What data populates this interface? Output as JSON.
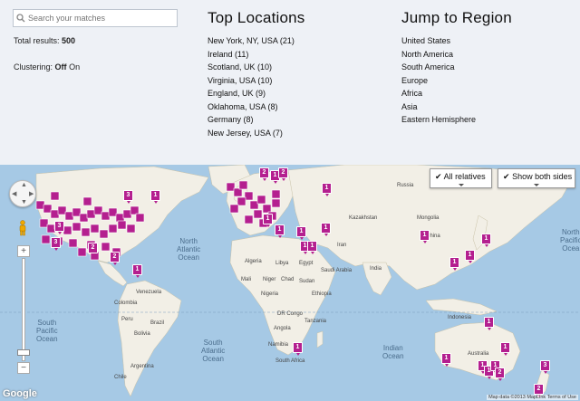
{
  "search": {
    "placeholder": "Search your matches"
  },
  "total": {
    "label": "Total results:",
    "value": "500"
  },
  "clustering": {
    "label": "Clustering:",
    "off": "Off",
    "on": "On"
  },
  "top_locations": {
    "title": "Top Locations",
    "items": [
      "New York, NY, USA (21)",
      "Ireland (11)",
      "Scotland, UK (10)",
      "Virginia, USA (10)",
      "England, UK (9)",
      "Oklahoma, USA (8)",
      "Germany (8)",
      "New Jersey, USA (7)"
    ]
  },
  "jump_to_region": {
    "title": "Jump to Region",
    "items": [
      "United States",
      "North America",
      "South America",
      "Europe",
      "Africa",
      "Asia",
      "Eastern Hemisphere"
    ]
  },
  "map": {
    "buttons": {
      "relatives": "All relatives",
      "sides": "Show both sides"
    },
    "zoom_in": "+",
    "zoom_out": "−",
    "oceans": {
      "north_pacific": "North\nPacific\nOcean",
      "north_atlantic": "North\nAtlantic\nOcean",
      "south_pacific": "South\nPacific\nOcean",
      "south_atlantic": "South\nAtlantic\nOcean",
      "indian": "Indian\nOcean",
      "north_pacific_east": "North\nPacific\nOcea"
    },
    "countries": {
      "russia": "Russia",
      "kazakhstan": "Kazakhstan",
      "mongolia": "Mongolia",
      "china": "China",
      "iran": "Iran",
      "algeria": "Algeria",
      "libya": "Libya",
      "egypt": "Egypt",
      "saudi": "Saudi Arabia",
      "india": "India",
      "mali": "Mali",
      "niger": "Niger",
      "chad": "Chad",
      "sudan": "Sudan",
      "nigeria": "Nigeria",
      "ethiopia": "Ethiopia",
      "drcongo": "DR Congo",
      "tanzania": "Tanzania",
      "angola": "Angola",
      "namibia": "Namibia",
      "south_africa": "South Africa",
      "indonesia": "Indonesia",
      "australia": "Australia",
      "brazil": "Brazil",
      "peru": "Peru",
      "bolivia": "Bolivia",
      "venezuela": "Venezuela",
      "colombia": "Colombia",
      "argentina": "Argentina",
      "chile": "Chile"
    },
    "markers": [
      "2",
      "1",
      "2",
      "3",
      "1",
      "1",
      "3",
      "2",
      "2",
      "1",
      "1",
      "1",
      "1",
      "1",
      "1",
      "1",
      "1",
      "1",
      "1",
      "1",
      "1",
      "1",
      "1",
      "3",
      "2",
      "3",
      "1",
      "2",
      "1",
      "1",
      "1"
    ],
    "google": "Google",
    "attribution": "Map data ©2013 MapLink",
    "terms": "Terms of Use"
  }
}
